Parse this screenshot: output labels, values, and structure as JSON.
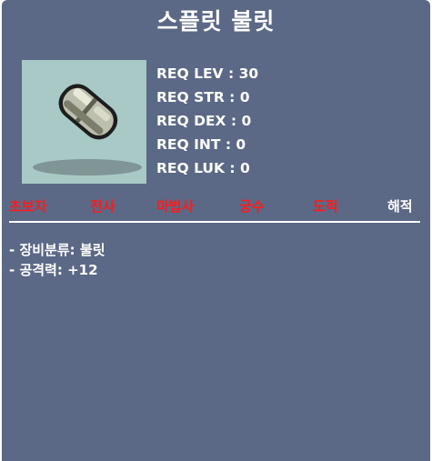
{
  "item": {
    "name": "스플릿 불릿"
  },
  "requirements": [
    {
      "label": "REQ LEV",
      "value": "30"
    },
    {
      "label": "REQ STR",
      "value": "0"
    },
    {
      "label": "REQ DEX",
      "value": "0"
    },
    {
      "label": "REQ INT",
      "value": "0"
    },
    {
      "label": "REQ LUK",
      "value": "0"
    }
  ],
  "jobs": [
    {
      "name": "초보자",
      "color": "#ff1a1a"
    },
    {
      "name": "전사",
      "color": "#ff1a1a"
    },
    {
      "name": "마법사",
      "color": "#ff1a1a"
    },
    {
      "name": "궁수",
      "color": "#ff1a1a"
    },
    {
      "name": "도적",
      "color": "#ff1a1a"
    },
    {
      "name": "해적",
      "color": "#ffffff"
    }
  ],
  "stats": [
    {
      "label": "- 장비분류",
      "value": "불릿"
    },
    {
      "label": "- 공격력",
      "value": "+12"
    }
  ],
  "icons": {
    "item_icon": "bullet-icon"
  }
}
